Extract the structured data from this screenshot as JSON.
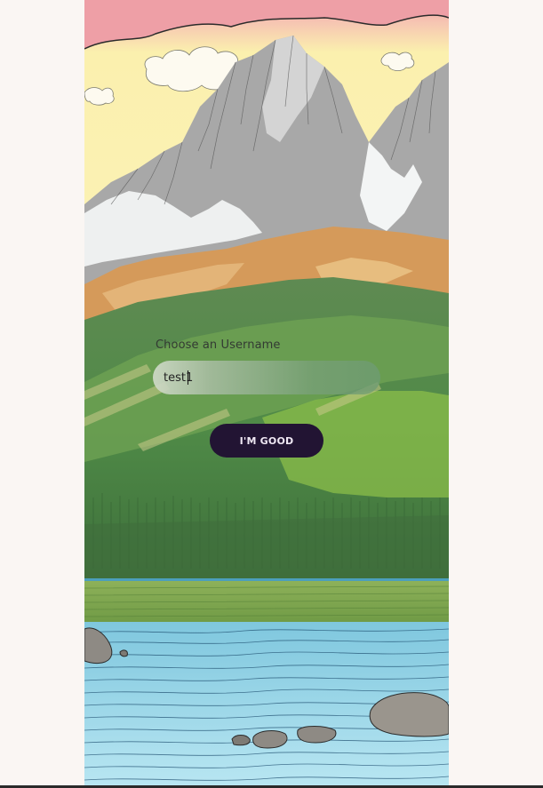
{
  "username": {
    "label": "Choose an Username",
    "value": "test1"
  },
  "submit": {
    "label": "I'M GOOD"
  },
  "colors": {
    "page_background": "#faf6f3",
    "button_background": "#221433",
    "button_text": "#efe7f3",
    "sky_top": "#eea3a8",
    "sky": "#fbf1b0",
    "water": "#9fd7ea"
  }
}
